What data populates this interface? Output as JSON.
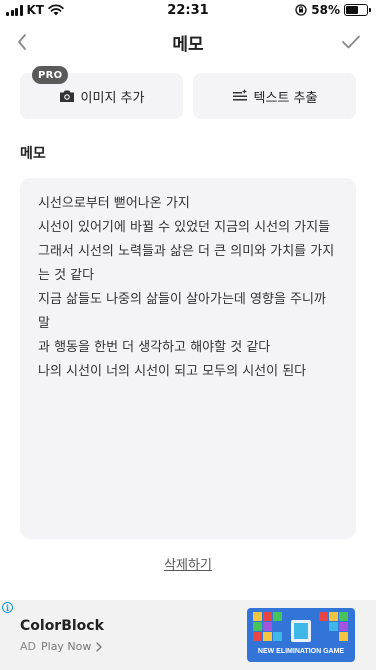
{
  "status_bar": {
    "carrier": "KT",
    "time": "22:31",
    "battery_percent": "58%",
    "battery_level": 0.58
  },
  "nav": {
    "title": "메모"
  },
  "actions": {
    "pro_badge": "PRO",
    "add_image_label": "이미지 추가",
    "extract_text_label": "텍스트 추출"
  },
  "memo": {
    "section_label": "메모",
    "lines": [
      "시선으로부터 뻗어나온 가지",
      "시선이 있어기에 바뀔 수 있었던 지금의 시선의 가지들",
      "그래서 시선의 노력들과 삶은 더 큰 의미와 가치를 가지",
      "는 것 같다",
      "지금 삶들도 나중의 삶들이 살아가는데 영향을 주니까 말",
      "과 행동을 한번 더 생각하고 해야할 것 같다",
      "나의 시선이 너의 시선이 되고 모두의 시선이 된다"
    ]
  },
  "delete_label": "삭제하기",
  "ad": {
    "title": "ColorBlock",
    "tag": "AD",
    "cta": "Play Now",
    "image_caption": "NEW ELIMINATION GAME"
  },
  "colors": {
    "surface": "#f4f4f6",
    "ad_info": "#1a9bd7"
  }
}
